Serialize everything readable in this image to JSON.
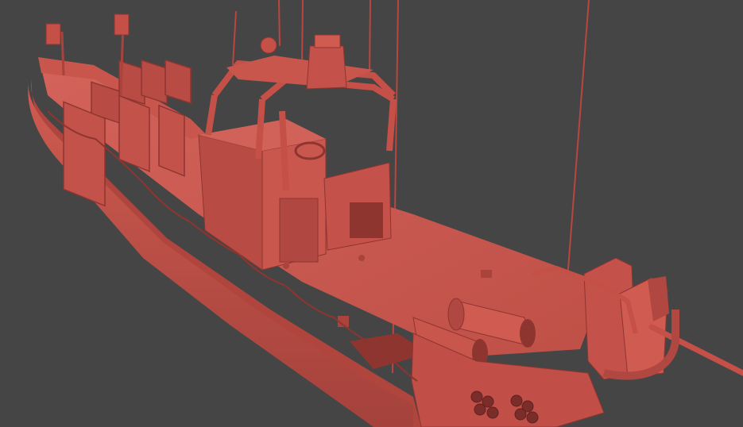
{
  "scene": {
    "subject": "boat-clay-render",
    "colors": {
      "background": "#454545",
      "model_base": "#c45048",
      "model_dark": "#8e3530",
      "model_mid": "#a9433c",
      "model_light": "#d8675d",
      "antenna": "#b9463f"
    }
  }
}
